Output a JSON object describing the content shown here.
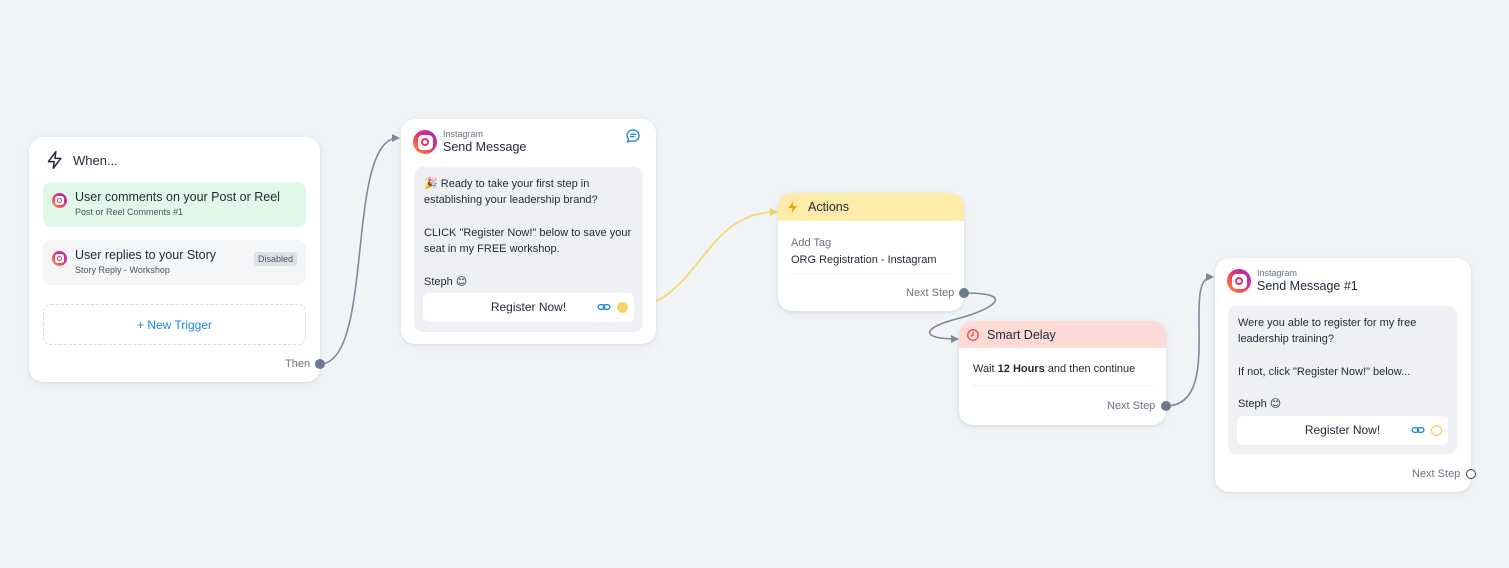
{
  "trigger": {
    "title": "When...",
    "items": [
      {
        "title": "User comments on your Post or Reel",
        "subtitle": "Post or Reel Comments #1"
      },
      {
        "title": "User replies to your Story",
        "subtitle": "Story Reply - Workshop",
        "badge": "Disabled"
      }
    ],
    "new_trigger_label": "+ New Trigger",
    "output_label": "Then"
  },
  "send_message": {
    "source": "Instagram",
    "title": "Send Message",
    "lines": [
      "🎉 Ready to take your first step in",
      "establishing your leadership brand?",
      "",
      "CLICK \"Register Now!\" below to save your",
      "seat in my FREE workshop.",
      "",
      "Steph 😊"
    ],
    "button_label": "Register Now!"
  },
  "actions": {
    "title": "Actions",
    "field_label": "Add Tag",
    "field_value": "ORG Registration - Instagram",
    "output_label": "Next Step"
  },
  "smart_delay": {
    "title": "Smart Delay",
    "wait_prefix": "Wait",
    "wait_value": "12 Hours",
    "wait_suffix": "and then continue",
    "output_label": "Next Step"
  },
  "send_message_2": {
    "source": "Instagram",
    "title": "Send Message #1",
    "lines": [
      "Were you able to register for my free",
      "leadership training?",
      "",
      "If not, click \"Register Now!\" below...",
      "",
      "Steph 😊"
    ],
    "button_label": "Register Now!",
    "output_label": "Next Step"
  },
  "colors": {
    "canvas": "#f1f4f7",
    "wire": "#7d8a9c",
    "button_wire": "#f6d365",
    "trigger_active": "#e1f7e7",
    "actions_header": "#fdebaa",
    "delay_header": "#fddad6",
    "link": "#1d87d9"
  },
  "icons": {
    "trigger": "lightning-icon",
    "channel": "instagram-icon",
    "comment": "chat-bubble-icon",
    "actions": "lightning-icon",
    "delay": "clock-icon",
    "button_link": "link-icon"
  }
}
